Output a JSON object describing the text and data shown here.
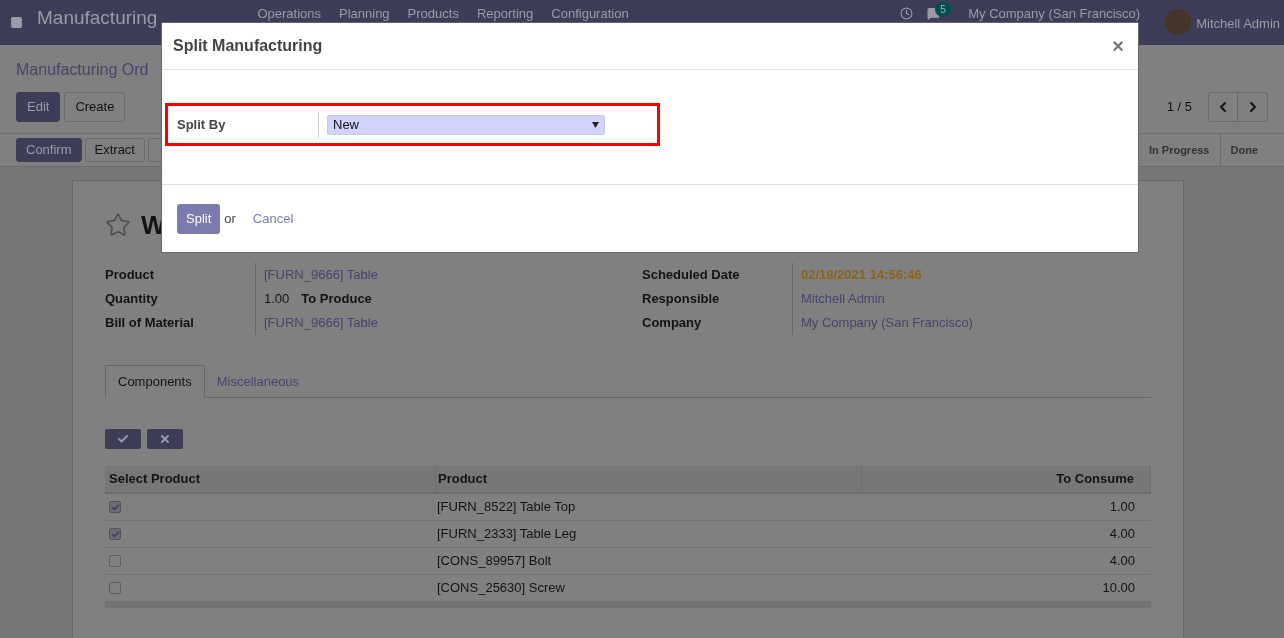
{
  "navbar": {
    "app_name": "Manufacturing",
    "menu": [
      "Operations",
      "Planning",
      "Products",
      "Reporting",
      "Configuration"
    ],
    "messages_count": "5",
    "company": "My Company (San Francisco)",
    "user": "Mitchell Admin"
  },
  "breadcrumb": "Manufacturing Ord",
  "actions": [
    "Edit",
    "Create"
  ],
  "pager": "1 / 5",
  "status_buttons": [
    "Confirm",
    "Extract"
  ],
  "stages": [
    {
      "label": "In Progress",
      "selected": false
    },
    {
      "label": "Done",
      "selected": false
    }
  ],
  "record": {
    "title": "W",
    "starred": false,
    "left_fields": [
      {
        "label": "Product",
        "value": "[FURN_9666] Table",
        "kind": "link"
      },
      {
        "label": "Quantity",
        "value": "1.00",
        "suffix": "To Produce",
        "kind": "qty"
      },
      {
        "label": "Bill of Material",
        "value": "[FURN_9666] Table",
        "kind": "link"
      }
    ],
    "right_fields": [
      {
        "label": "Scheduled Date",
        "value": "02/18/2021 14:56:46",
        "kind": "warning"
      },
      {
        "label": "Responsible",
        "value": "Mitchell Admin",
        "kind": "link"
      },
      {
        "label": "Company",
        "value": "My Company (San Francisco)",
        "kind": "link"
      }
    ]
  },
  "tabs": [
    {
      "label": "Components",
      "selected": true
    },
    {
      "label": "Miscellaneous",
      "selected": false
    }
  ],
  "table": {
    "columns": [
      "Select Product",
      "Product",
      "To Consume"
    ],
    "rows": [
      {
        "checked": true,
        "product": "[FURN_8522] Table Top",
        "to_consume": "1.00"
      },
      {
        "checked": true,
        "product": "[FURN_2333] Table Leg",
        "to_consume": "4.00"
      },
      {
        "checked": false,
        "product": "[CONS_89957] Bolt",
        "to_consume": "4.00"
      },
      {
        "checked": false,
        "product": "[CONS_25630] Screw",
        "to_consume": "10.00"
      }
    ]
  },
  "dialog": {
    "title": "Split Manufacturing",
    "close": "×",
    "field_label": "Split By",
    "field_value": "New",
    "primary": "Split",
    "or": "or",
    "cancel": "Cancel"
  }
}
